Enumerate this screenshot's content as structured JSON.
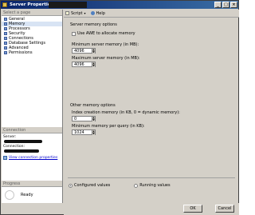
{
  "window": {
    "title": "Server Properties"
  },
  "titlebar": {
    "min": "_",
    "max": "□",
    "close": "×"
  },
  "left": {
    "select_page_header": "Select a page",
    "pages": [
      "General",
      "Memory",
      "Processors",
      "Security",
      "Connections",
      "Database Settings",
      "Advanced",
      "Permissions"
    ],
    "connection_header": "Connection",
    "server_label": "Server:",
    "connection_label": "Connection:",
    "view_conn_link": "View connection properties",
    "progress_header": "Progress",
    "ready_text": "Ready"
  },
  "toolbar": {
    "script_label": "Script",
    "help_label": "Help",
    "caret": "▾"
  },
  "memory": {
    "group_title": "Server memory options",
    "awe_label": "Use AWE to allocate memory",
    "min_label": "Minimum server memory (in MB):",
    "min_value": "4096",
    "max_label": "Maximum server memory (in MB):",
    "max_value": "4096"
  },
  "other": {
    "group_title": "Other memory options",
    "index_label": "Index creation memory (in KB, 0 = dynamic memory):",
    "index_value": "0",
    "query_label": "Minimum memory per query (in KB):",
    "query_value": "1024"
  },
  "radios": {
    "configured": "Configured values",
    "running": "Running values"
  },
  "buttons": {
    "ok": "OK",
    "cancel": "Cancel"
  },
  "spin": {
    "up": "▲",
    "down": "▼"
  }
}
